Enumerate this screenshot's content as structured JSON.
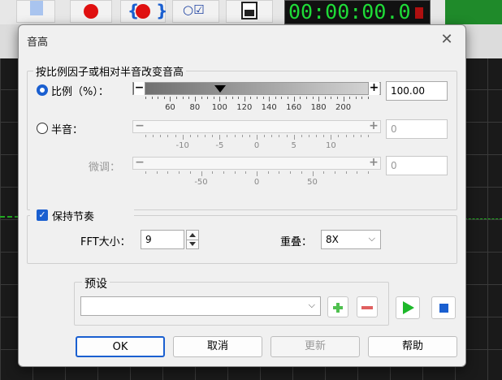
{
  "dialog": {
    "title": "音高",
    "close_glyph": "✕"
  },
  "background": {
    "timer": "00:00:00.0"
  },
  "pitch_group": {
    "legend": "按比例因子或相对半音改变音高",
    "ratio": {
      "label": "比例（%）：",
      "value": "100.00",
      "selected": true,
      "ticks": [
        "60",
        "80",
        "100",
        "120",
        "140",
        "160",
        "180",
        "200"
      ],
      "slider_min": 40,
      "slider_max": 210,
      "slider_value": 100
    },
    "semitone": {
      "label": "半音：",
      "value": "0",
      "selected": false,
      "ticks": [
        "-10",
        "-5",
        "0",
        "5",
        "10"
      ]
    },
    "fine": {
      "label": "微调：",
      "value": "0",
      "ticks": [
        "-50",
        "0",
        "50"
      ]
    },
    "slider_minus": "−",
    "slider_plus": "+"
  },
  "tempo_group": {
    "keep_tempo_label": "保持节奏",
    "keep_tempo_checked": true,
    "fft_label": "FFT大小：",
    "fft_value": "9",
    "overlap_label": "重叠：",
    "overlap_value": "8X"
  },
  "preset_group": {
    "legend": "预设",
    "value": ""
  },
  "buttons": {
    "ok": "OK",
    "cancel": "取消",
    "update": "更新",
    "help": "帮助"
  },
  "colors": {
    "accent": "#1a5fd0",
    "play_green": "#1db82a",
    "stop_blue": "#1a5fd0",
    "add_green": "#4fc04f",
    "remove_red": "#e06060"
  }
}
